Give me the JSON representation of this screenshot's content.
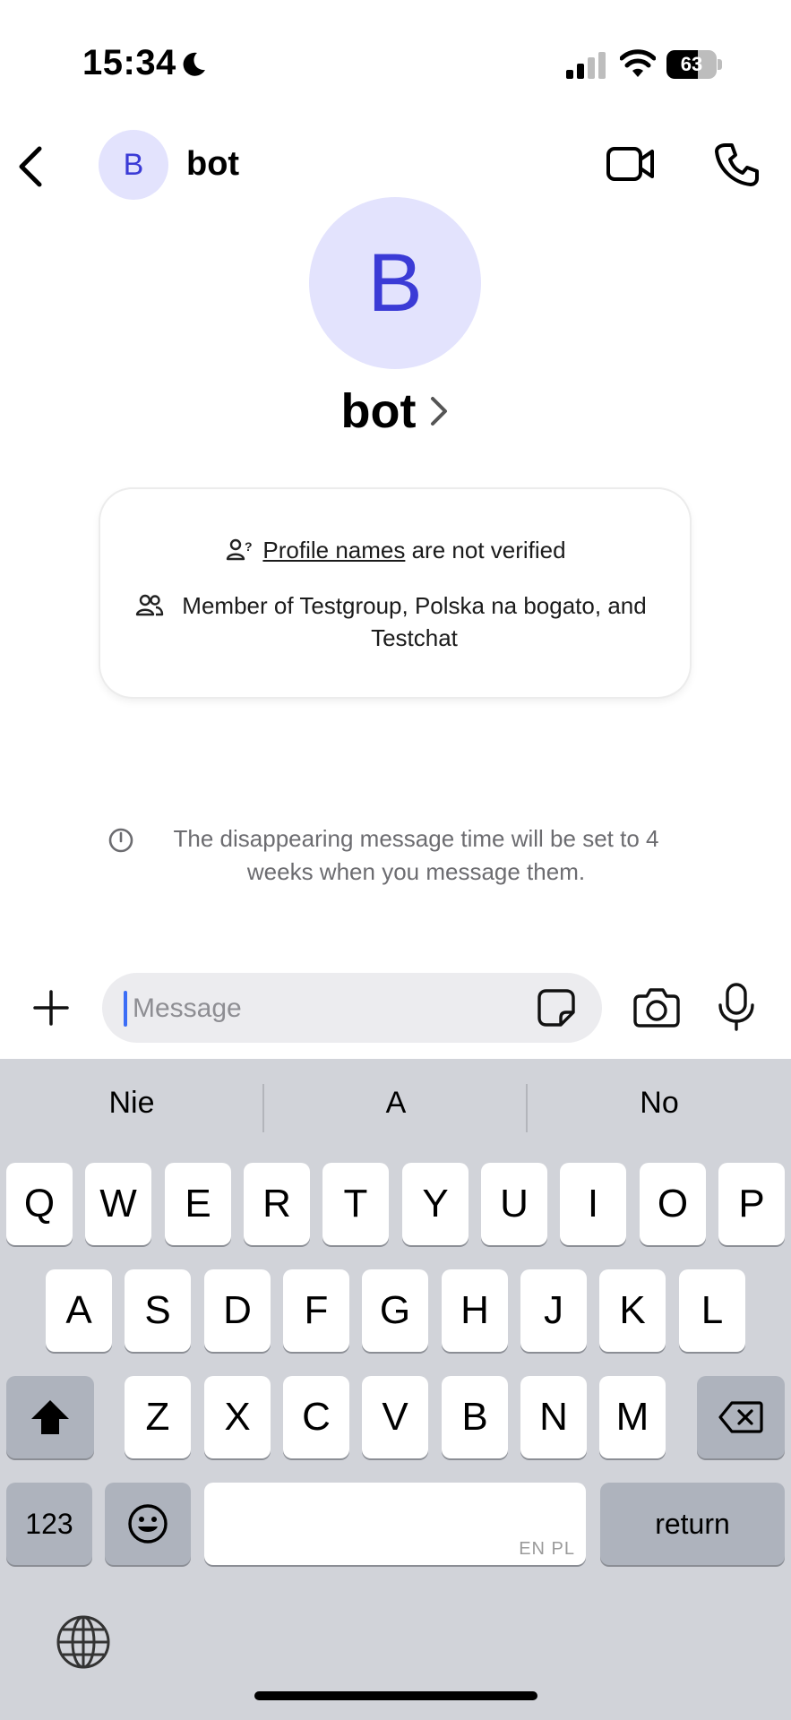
{
  "status_bar": {
    "time": "15:34",
    "battery": "63",
    "battery_level": 0.63
  },
  "header": {
    "back_icon": "chevron-left-icon",
    "avatar_initial": "B",
    "title": "bot",
    "video_icon": "video-camera-icon",
    "call_icon": "phone-icon"
  },
  "profile": {
    "avatar_initial": "B",
    "name": "bot"
  },
  "info_card": {
    "verified_prefix": "Profile names",
    "verified_suffix": " are not verified",
    "members": "Member of Testgroup, Polska na bogato, and Testchat"
  },
  "disappearing_notice": "The disappearing message time will be set to 4 weeks when you message them.",
  "composer": {
    "placeholder": "Message",
    "value": ""
  },
  "keyboard": {
    "suggestions": [
      "Nie",
      "A",
      "No"
    ],
    "row1": [
      "Q",
      "W",
      "E",
      "R",
      "T",
      "Y",
      "U",
      "I",
      "O",
      "P"
    ],
    "row2": [
      "A",
      "S",
      "D",
      "F",
      "G",
      "H",
      "J",
      "K",
      "L"
    ],
    "row3": [
      "Z",
      "X",
      "C",
      "V",
      "B",
      "N",
      "M"
    ],
    "numbers_label": "123",
    "return_label": "return",
    "space_hint": "EN PL"
  },
  "colors": {
    "accent": "#3b3bd6",
    "avatar_bg": "#e3e3fd",
    "keyboard_bg": "#d1d3d9"
  }
}
